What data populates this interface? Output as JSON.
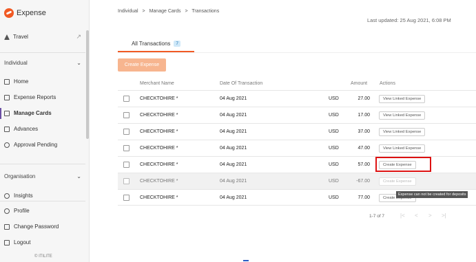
{
  "sidebar": {
    "logo_text": "Expense",
    "travel_label": "Travel",
    "individual_title": "Individual",
    "individual_items": [
      {
        "label": "Home"
      },
      {
        "label": "Expense Reports"
      },
      {
        "label": "Manage Cards"
      },
      {
        "label": "Advances"
      },
      {
        "label": "Approval Pending"
      }
    ],
    "organisation_title": "Organisation",
    "organisation_items": [
      {
        "label": "Insights"
      }
    ],
    "bottom_items": [
      {
        "label": "Profile"
      },
      {
        "label": "Change Password"
      },
      {
        "label": "Logout"
      }
    ],
    "copyright": "© ITILITE"
  },
  "breadcrumb": [
    "Individual",
    ">",
    "Manage Cards",
    ">",
    "Transactions"
  ],
  "last_updated": "Last updated: 25 Aug 2021, 6:08 PM",
  "tab": {
    "label": "All Transactions",
    "count": "7"
  },
  "create_expense_label": "Create Expense",
  "table": {
    "headers": [
      "Merchant Name",
      "Date Of Transaction",
      "Amount",
      "Actions"
    ],
    "rows": [
      {
        "merchant": "CHECKTOHIRE *",
        "date": "04 Aug 2021",
        "currency": "USD",
        "amount": "27.00",
        "action": "View Linked Expense"
      },
      {
        "merchant": "CHECKTOHIRE *",
        "date": "04 Aug 2021",
        "currency": "USD",
        "amount": "17.00",
        "action": "View Linked Expense"
      },
      {
        "merchant": "CHECKTOHIRE *",
        "date": "04 Aug 2021",
        "currency": "USD",
        "amount": "37.00",
        "action": "View Linked Expense"
      },
      {
        "merchant": "CHECKTOHIRE *",
        "date": "04 Aug 2021",
        "currency": "USD",
        "amount": "47.00",
        "action": "View Linked Expense"
      },
      {
        "merchant": "CHECKTOHIRE *",
        "date": "04 Aug 2021",
        "currency": "USD",
        "amount": "57.00",
        "action": "Create Expense"
      },
      {
        "merchant": "CHECKTOHIRE *",
        "date": "04 Aug 2021",
        "currency": "USD",
        "amount": "-67.00",
        "action": "Create Expense"
      },
      {
        "merchant": "CHECKTOHIRE *",
        "date": "04 Aug 2021",
        "currency": "USD",
        "amount": "77.00",
        "action": "Create Expense"
      }
    ]
  },
  "tooltip": "Expense can not be created for deposits",
  "pagination": {
    "text": "1-7 of 7"
  },
  "colors": {
    "accent": "#f15a24",
    "highlight_box": "#dd1111"
  }
}
